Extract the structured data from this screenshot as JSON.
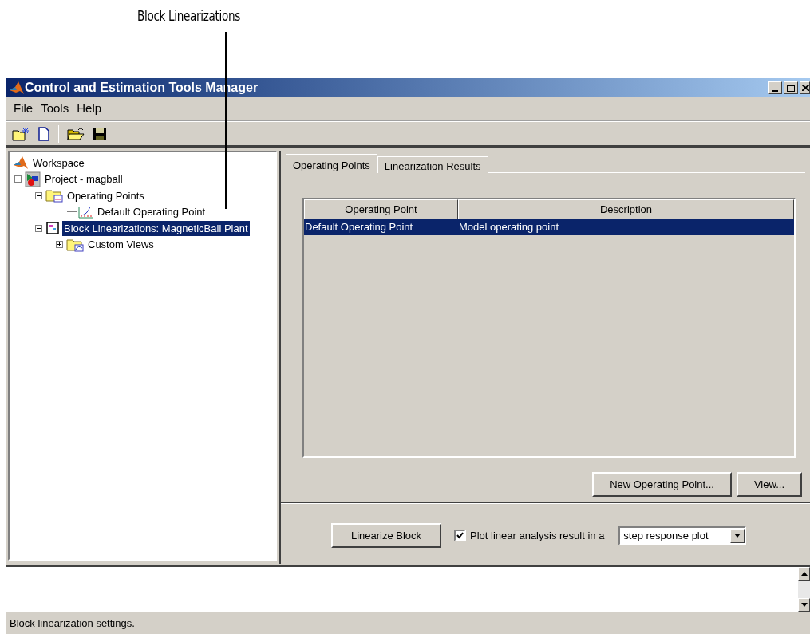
{
  "callout": {
    "label": "Block Linearizations"
  },
  "window": {
    "title": "Control and Estimation Tools Manager"
  },
  "menu": [
    "File",
    "Tools",
    "Help"
  ],
  "tree": [
    {
      "label": "Workspace",
      "kind": "workspace",
      "selected": false,
      "children": [
        {
          "label": "Project - magball",
          "kind": "project",
          "selected": false,
          "expanded": true,
          "children": [
            {
              "label": "Operating Points",
              "kind": "folder",
              "selected": false,
              "expanded": true,
              "children": [
                {
                  "label": "Default Operating Point",
                  "kind": "point",
                  "selected": false
                }
              ]
            },
            {
              "label": "Block Linearizations: MagneticBall Plant",
              "kind": "block",
              "selected": true,
              "expanded": true,
              "children": [
                {
                  "label": "Custom Views",
                  "kind": "views",
                  "selected": false,
                  "expanded": false
                }
              ]
            }
          ]
        }
      ]
    }
  ],
  "tabs": [
    {
      "label": "Operating Points",
      "selected": true
    },
    {
      "label": "Linearization Results",
      "selected": false
    }
  ],
  "table": {
    "columns": [
      "Operating Point",
      "Description"
    ],
    "rows": [
      {
        "cells": [
          "Default Operating Point",
          "Model operating point"
        ],
        "selected": true
      }
    ]
  },
  "table_buttons": [
    "New Operating Point...",
    "View..."
  ],
  "linearize_button": "Linearize Block",
  "plot_option": {
    "label": "Plot linear analysis result in a",
    "checked": true
  },
  "plot_type": {
    "value": "step response plot"
  },
  "status_bar": "Block linearization settings."
}
